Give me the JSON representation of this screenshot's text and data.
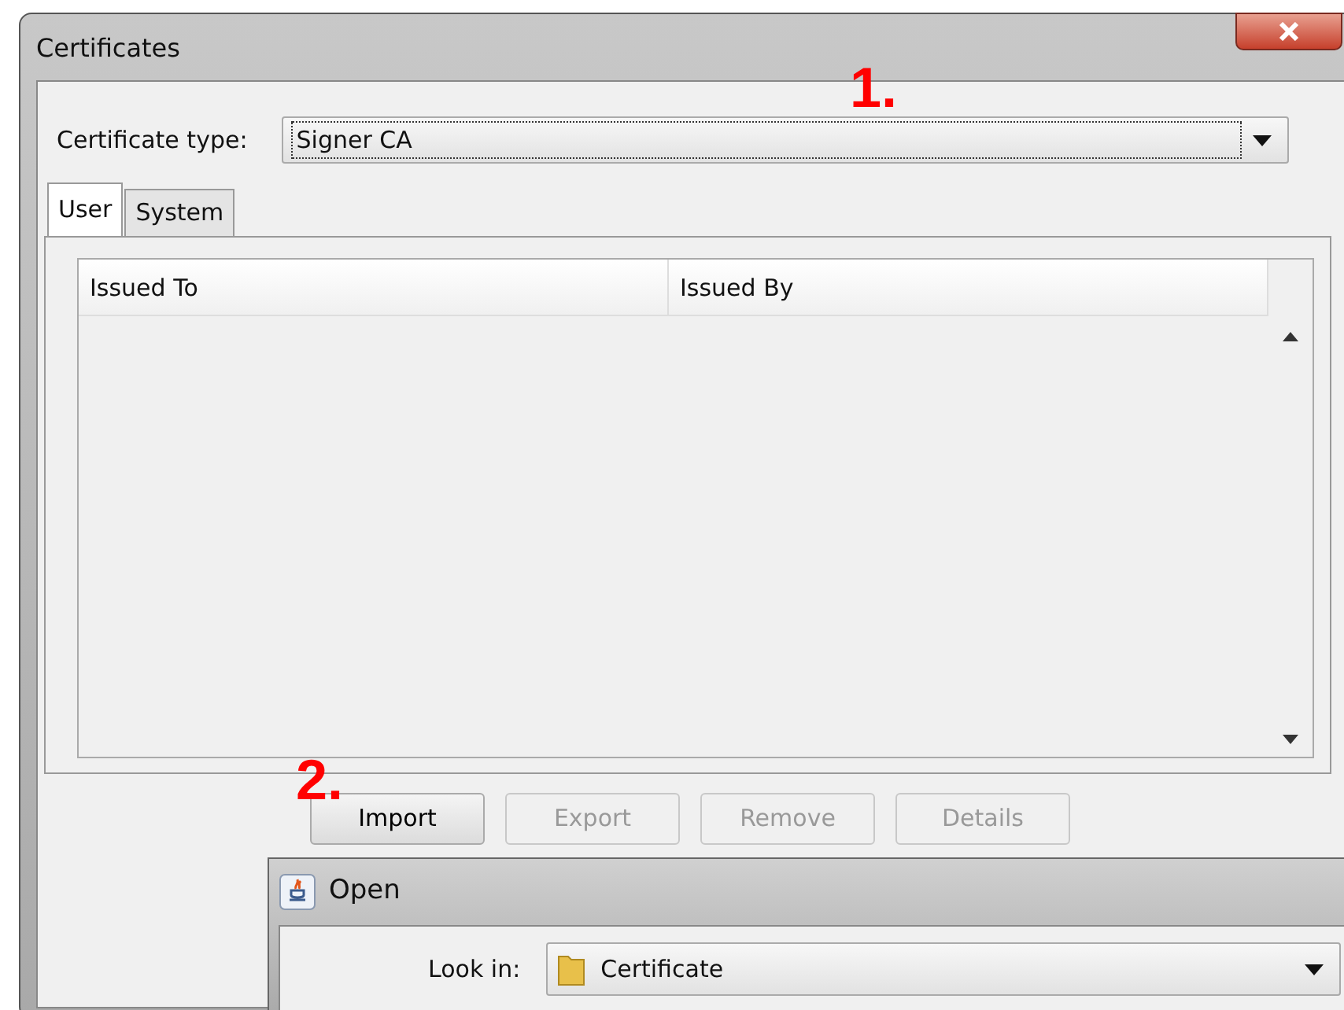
{
  "window": {
    "title": "Certificates"
  },
  "certificate_type": {
    "label": "Certificate type:",
    "value": "Signer CA"
  },
  "tabs": [
    {
      "label": "User",
      "selected": true
    },
    {
      "label": "System",
      "selected": false
    }
  ],
  "table": {
    "columns": [
      "Issued To",
      "Issued By"
    ]
  },
  "buttons": [
    {
      "label": "Import",
      "disabled": false
    },
    {
      "label": "Export",
      "disabled": true
    },
    {
      "label": "Remove",
      "disabled": true
    },
    {
      "label": "Details",
      "disabled": true
    }
  ],
  "annotations": [
    "1.",
    "2."
  ],
  "open_dialog": {
    "title": "Open",
    "look_in": {
      "label": "Look in:",
      "value": "Certificate"
    }
  }
}
